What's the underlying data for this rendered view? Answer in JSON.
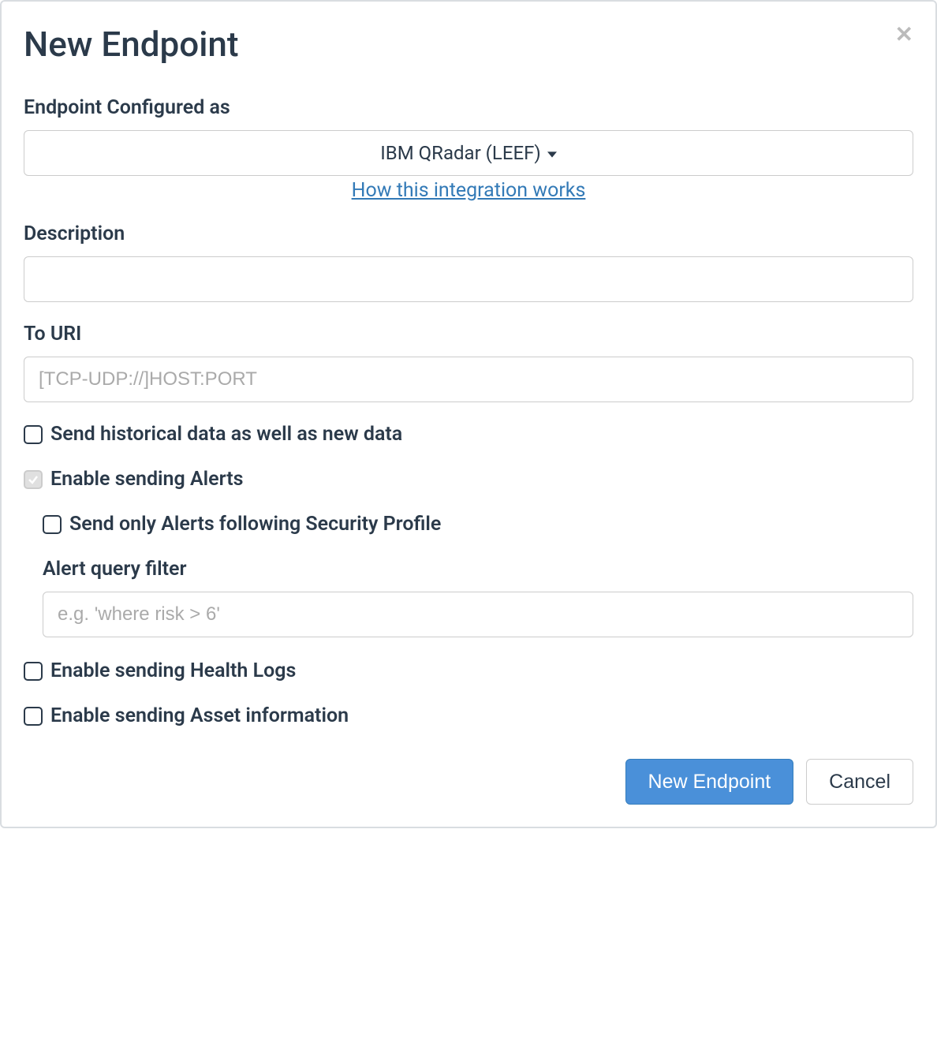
{
  "modal": {
    "title": "New Endpoint",
    "fields": {
      "configured_as": {
        "label": "Endpoint Configured as",
        "selected": "IBM QRadar (LEEF)",
        "help_link": "How this integration works"
      },
      "description": {
        "label": "Description",
        "value": ""
      },
      "to_uri": {
        "label": "To URI",
        "placeholder": "[TCP-UDP://]HOST:PORT",
        "value": ""
      }
    },
    "checkboxes": {
      "send_historical": {
        "label": "Send historical data as well as new data",
        "checked": false
      },
      "enable_alerts": {
        "label": "Enable sending Alerts",
        "checked": true,
        "disabled": true
      },
      "send_only_security_profile": {
        "label": "Send only Alerts following Security Profile",
        "checked": false
      },
      "alert_query_filter": {
        "label": "Alert query filter",
        "placeholder": "e.g. 'where risk > 6'",
        "value": ""
      },
      "enable_health_logs": {
        "label": "Enable sending Health Logs",
        "checked": false
      },
      "enable_asset_info": {
        "label": "Enable sending Asset information",
        "checked": false
      }
    },
    "buttons": {
      "submit": "New Endpoint",
      "cancel": "Cancel"
    }
  },
  "colors": {
    "primary": "#4a90d9",
    "text": "#2b3a4a",
    "link": "#337ab7",
    "border": "#ccc"
  }
}
